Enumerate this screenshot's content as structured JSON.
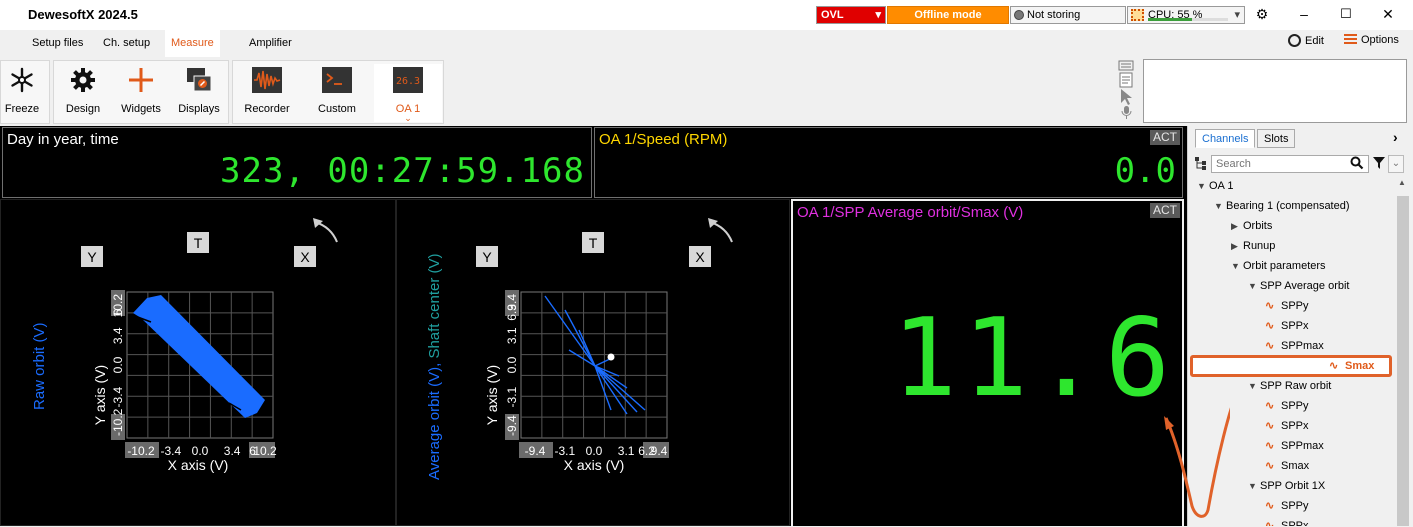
{
  "app": {
    "title": "DewesoftX 2024.5"
  },
  "status": {
    "ovl_label": "OVL",
    "mode_label": "Offline mode",
    "storing_label": "Not storing",
    "cpu_label": "CPU: 55 %",
    "cpu_percent": 55
  },
  "menu": {
    "tabs": [
      "Setup files",
      "Ch. setup",
      "Measure",
      "Amplifier"
    ],
    "active_tab": "Measure",
    "edit_label": "Edit",
    "options_label": "Options"
  },
  "toolbar": {
    "freeze": "Freeze",
    "design": "Design",
    "widgets": "Widgets",
    "displays": "Displays",
    "recorder": "Recorder",
    "custom": "Custom",
    "oa1": "OA 1",
    "oa1_icon_text": "26.3"
  },
  "panels": {
    "time": {
      "title": "Day in year, time",
      "value": "323, 00:27:59.168"
    },
    "speed": {
      "title": "OA 1/Speed (RPM)",
      "value": "0.0",
      "act": "ACT"
    },
    "raw_orbit": {
      "button_y": "Y",
      "button_t": "T",
      "button_x": "X",
      "side_label": "Raw orbit (V)",
      "y_axis_label": "Y axis (V)",
      "x_axis_label": "X axis (V)",
      "x_ticks": [
        "-10.2",
        "-3.4",
        "0.0",
        "3.4",
        "6",
        "10.2"
      ],
      "y_ticks": [
        "-10.2",
        "-3.4",
        "0.0",
        "3.4",
        "6",
        "10.2"
      ]
    },
    "avg_orbit": {
      "button_y": "Y",
      "button_t": "T",
      "button_x": "X",
      "side_label": "Average orbit (V), Shaft center (V)",
      "side_label_a": "Average orbit (V), ",
      "side_label_b": "Shaft center (V)",
      "y_axis_label": "Y axis (V)",
      "x_axis_label": "X axis (V)",
      "x_ticks": [
        "-9.4",
        "-3.1",
        "0.0",
        "3.1",
        "6.2",
        "9.4"
      ],
      "y_ticks": [
        "-9.4",
        "-3.1",
        "0.0",
        "3.1",
        "6.3",
        "9.4"
      ]
    },
    "smax": {
      "title": "OA 1/SPP Average orbit/Smax (V)",
      "value": "11.6",
      "act": "ACT"
    }
  },
  "right_panel": {
    "tabs": [
      "Channels",
      "Slots"
    ],
    "active_tab": "Channels",
    "search_placeholder": "Search",
    "tree": [
      {
        "label": "OA 1",
        "level": 0,
        "kind": "group"
      },
      {
        "label": "Bearing 1 (compensated)",
        "level": 1,
        "kind": "group"
      },
      {
        "label": "Orbits",
        "level": 2,
        "kind": "collapsed"
      },
      {
        "label": "Runup",
        "level": 2,
        "kind": "collapsed"
      },
      {
        "label": "Orbit parameters",
        "level": 2,
        "kind": "group"
      },
      {
        "label": "SPP Average orbit",
        "level": 3,
        "kind": "group"
      },
      {
        "label": "SPPy",
        "level": 4,
        "kind": "channel"
      },
      {
        "label": "SPPx",
        "level": 4,
        "kind": "channel"
      },
      {
        "label": "SPPmax",
        "level": 4,
        "kind": "channel"
      },
      {
        "label": "Smax",
        "level": 4,
        "kind": "channel",
        "highlighted": true
      },
      {
        "label": "SPP Raw orbit",
        "level": 3,
        "kind": "group"
      },
      {
        "label": "SPPy",
        "level": 4,
        "kind": "channel"
      },
      {
        "label": "SPPx",
        "level": 4,
        "kind": "channel"
      },
      {
        "label": "SPPmax",
        "level": 4,
        "kind": "channel"
      },
      {
        "label": "Smax",
        "level": 4,
        "kind": "channel"
      },
      {
        "label": "SPP Orbit 1X",
        "level": 3,
        "kind": "group"
      },
      {
        "label": "SPPy",
        "level": 4,
        "kind": "channel"
      },
      {
        "label": "SPPx",
        "level": 4,
        "kind": "channel"
      }
    ]
  },
  "colors": {
    "accent": "#e05a1a",
    "digital_green": "#2ee62e",
    "speed_yellow": "#ffd700",
    "smax_magenta": "#e030e0",
    "orbit_blue": "#1a6cff",
    "highlight_border": "#e0622a"
  }
}
